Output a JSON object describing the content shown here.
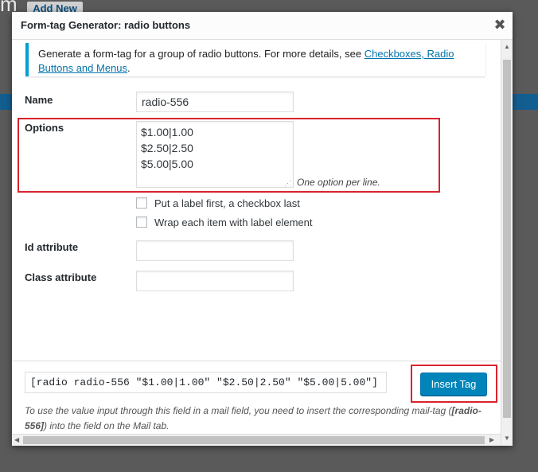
{
  "background": {
    "heading_fragment": "m",
    "add_new": "Add New"
  },
  "dialog": {
    "title": "Form-tag Generator: radio buttons",
    "close_glyph": "✖",
    "notice": {
      "text": "Generate a form-tag for a group of radio buttons. For more details, see ",
      "link": "Checkboxes, Radio Buttons and Menus",
      "suffix": "."
    },
    "fields": {
      "name_label": "Name",
      "name_value": "radio-556",
      "options_label": "Options",
      "options_value": "$1.00|1.00\n$2.50|2.50\n$5.00|5.00",
      "options_hint": "One option per line.",
      "checkbox_label_first": "Put a label first, a checkbox last",
      "checkbox_wrap_label": "Wrap each item with label element",
      "id_label": "Id attribute",
      "id_value": "",
      "class_label": "Class attribute",
      "class_value": ""
    },
    "insert": {
      "tag_value": "[radio radio-556 \"$1.00|1.00\" \"$2.50|2.50\" \"$5.00|5.00\"]",
      "button_label": "Insert Tag",
      "note_before": "To use the value input through this field in a mail field, you need to insert the corresponding mail-tag (",
      "note_tag": "[radio-556]",
      "note_after": ") into the field on the Mail tab."
    }
  },
  "colors": {
    "accent": "#0085ba",
    "highlight": "#d9232d",
    "notice_border": "#00a0d2"
  }
}
